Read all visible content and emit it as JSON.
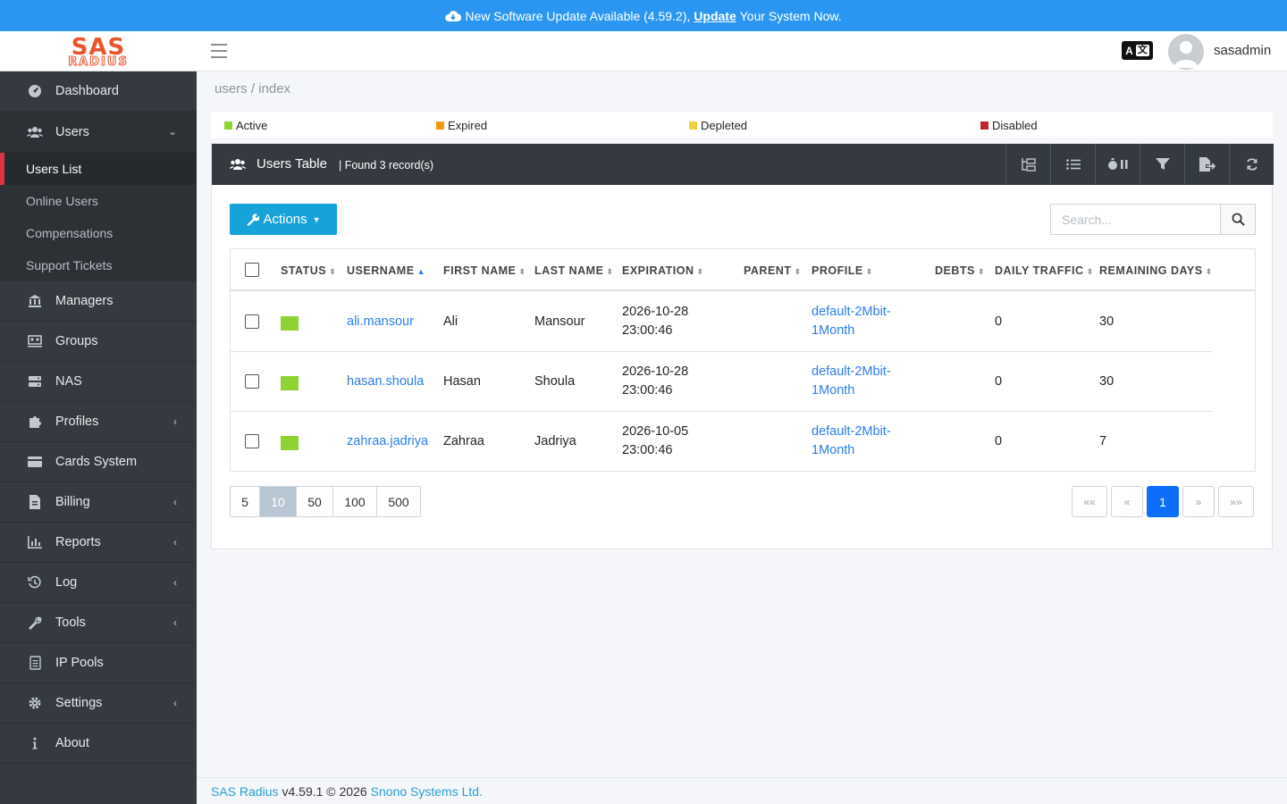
{
  "banner": {
    "text_before": "New Software Update Available (4.59.2),",
    "link": "Update",
    "text_after": "Your System Now."
  },
  "brand": {
    "line1": "SAS",
    "line2": "RADIUS"
  },
  "header": {
    "language_icon": "translate-icon",
    "username": "sasadmin"
  },
  "sidebar": {
    "dashboard": "Dashboard",
    "users": "Users",
    "users_sub": [
      "Users List",
      "Online Users",
      "Compensations",
      "Support Tickets"
    ],
    "managers": "Managers",
    "groups": "Groups",
    "nas": "NAS",
    "profiles": "Profiles",
    "cards": "Cards System",
    "billing": "Billing",
    "reports": "Reports",
    "log": "Log",
    "tools": "Tools",
    "ippools": "IP Pools",
    "settings": "Settings",
    "about": "About"
  },
  "breadcrumb": "users / index",
  "legend": [
    {
      "label": "Active",
      "color": "#8fd332"
    },
    {
      "label": "Expired",
      "color": "#f39c12"
    },
    {
      "label": "Depleted",
      "color": "#e8d13c"
    },
    {
      "label": "Disabled",
      "color": "#c0262f"
    }
  ],
  "table_card": {
    "title": "Users Table",
    "found": "| Found 3  record(s)",
    "actions_label": "Actions",
    "search_placeholder": "Search..."
  },
  "columns": [
    "STATUS",
    "USERNAME",
    "FIRST NAME",
    "LAST NAME",
    "EXPIRATION",
    "PARENT",
    "PROFILE",
    "DEBTS",
    "DAILY TRAFFIC",
    "REMAINING DAYS"
  ],
  "rows": [
    {
      "status": "#8fd332",
      "username": "ali.mansour",
      "first": "Ali",
      "last": "Mansour",
      "exp_date": "2026-10-28",
      "exp_time": "23:00:46",
      "parent": "",
      "profile1": "default-2Mbit-",
      "profile2": "1Month",
      "debts": "0",
      "traffic": "",
      "remaining": "30"
    },
    {
      "status": "#8fd332",
      "username": "hasan.shoula",
      "first": "Hasan",
      "last": "Shoula",
      "exp_date": "2026-10-28",
      "exp_time": "23:00:46",
      "parent": "",
      "profile1": "default-2Mbit-",
      "profile2": "1Month",
      "debts": "0",
      "traffic": "",
      "remaining": "30"
    },
    {
      "status": "#8fd332",
      "username": "zahraa.jadriya",
      "first": "Zahraa",
      "last": "Jadriya",
      "exp_date": "2026-10-05",
      "exp_time": "23:00:46",
      "parent": "",
      "profile1": "default-2Mbit-",
      "profile2": "1Month",
      "debts": "0",
      "traffic": "",
      "remaining": "7"
    }
  ],
  "page_sizes": [
    "5",
    "10",
    "50",
    "100",
    "500"
  ],
  "page_size_selected": "10",
  "pager": {
    "first": "««",
    "prev": "«",
    "current": "1",
    "next": "»",
    "last": "»»"
  },
  "footer": {
    "product": "SAS Radius",
    "version": "v4.59.1 © 2026",
    "company": "Snono Systems Ltd."
  }
}
